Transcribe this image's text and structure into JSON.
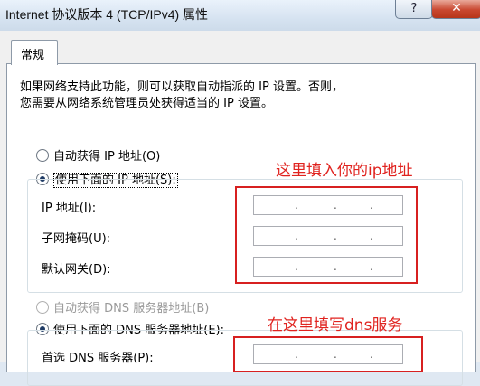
{
  "window": {
    "title": "Internet 协议版本 4 (TCP/IPv4) 属性",
    "help_label": "?",
    "close_label": "✕"
  },
  "tabs": [
    {
      "label": "常规"
    }
  ],
  "description": {
    "line1": "如果网络支持此功能，则可以获取自动指派的 IP 设置。否则，",
    "line2": "您需要从网络系统管理员处获得适当的 IP 设置。"
  },
  "ip_section": {
    "auto_label": "自动获得 IP 地址(O)",
    "manual_label": "使用下面的 IP 地址(S):",
    "fields": [
      {
        "label": "IP 地址(I):",
        "value": ""
      },
      {
        "label": "子网掩码(U):",
        "value": ""
      },
      {
        "label": "默认网关(D):",
        "value": ""
      }
    ]
  },
  "dns_section": {
    "auto_label": "自动获得 DNS 服务器地址(B)",
    "manual_label": "使用下面的 DNS 服务器地址(E):",
    "fields": [
      {
        "label": "首选 DNS 服务器(P):",
        "value": ""
      }
    ]
  },
  "ip_dot": ".",
  "annotations": {
    "ip_note": "这里填入你的ip地址",
    "dns_note": "在这里填写dns服务"
  },
  "colors": {
    "annotation_red": "#e0231f",
    "close_red": "#c9472f"
  }
}
